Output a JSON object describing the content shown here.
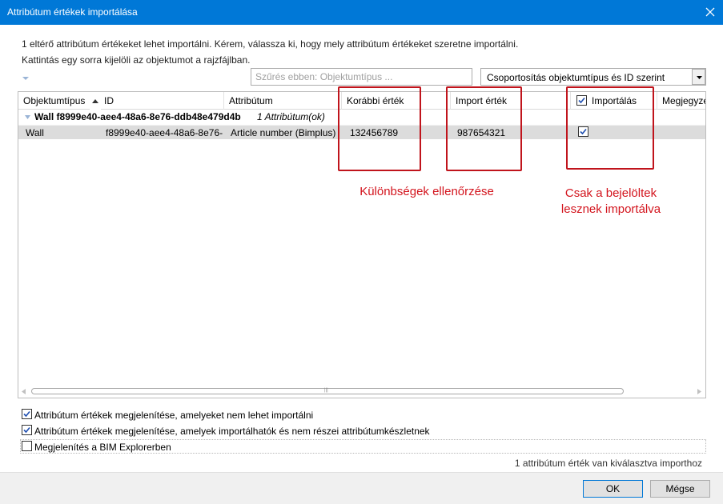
{
  "window": {
    "title": "Attribútum értékek importálása"
  },
  "intro": {
    "line1": "1 eltérő attribútum értékeket lehet importálni. Kérem, válassza ki, hogy mely attribútum értékeket szeretne importálni.",
    "line2": "Kattintás egy sorra kijelöli az objektumot a rajzfájlban."
  },
  "filter": {
    "placeholder": "Szűrés ebben: Objektumtípus ..."
  },
  "grouping": {
    "selected": "Csoportosítás objektumtípus és ID szerint"
  },
  "columns": {
    "type": "Objektumtípus",
    "id": "ID",
    "attribute": "Attribútum",
    "previous": "Korábbi érték",
    "import_value": "Import érték",
    "import": "Importálás",
    "note": "Megjegyzés"
  },
  "group": {
    "label": "Wall  f8999e40-aee4-48a6-8e76-ddb48e479d4b",
    "count": "1 Attribútum(ok)"
  },
  "rows": [
    {
      "type": "Wall",
      "id": "f8999e40-aee4-48a6-8e76-",
      "attribute": "Article number (Bimplus)",
      "previous": "132456789",
      "import_value": "987654321",
      "import_checked": true
    }
  ],
  "annotations": {
    "differences": "Különbségek ellenőrzése",
    "checked_line1": "Csak a bejelöltek",
    "checked_line2": "lesznek importálva"
  },
  "options": {
    "show_non_importable": {
      "label": "Attribútum értékek megjelenítése, amelyeket nem lehet importálni",
      "checked": true
    },
    "show_not_in_set": {
      "label": "Attribútum értékek megjelenítése, amelyek importálhatók és nem részei attribútumkészletnek",
      "checked": true
    },
    "show_in_bim_explorer": {
      "label": "Megjelenítés a BIM Explorerben",
      "checked": false
    }
  },
  "status": "1 attribútum érték van kiválasztva importhoz",
  "buttons": {
    "ok": "OK",
    "cancel": "Mégse"
  },
  "colors": {
    "titlebar": "#0078d7",
    "annotation": "#d3141d",
    "selected_row": "#dcdcdc"
  }
}
